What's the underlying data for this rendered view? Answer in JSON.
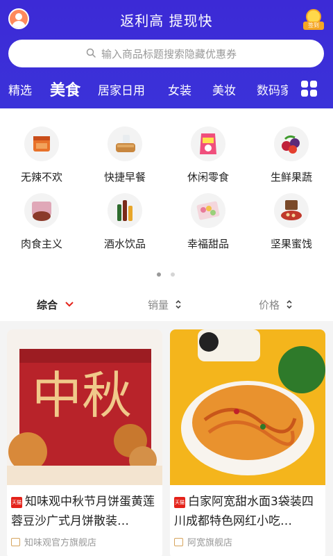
{
  "header": {
    "slogan": "返利高 提现快",
    "sign_badge_label": "签到"
  },
  "search": {
    "placeholder": "输入商品标题搜索隐藏优惠券"
  },
  "tabs": [
    {
      "label": "精选",
      "active": false
    },
    {
      "label": "美食",
      "active": true
    },
    {
      "label": "居家日用",
      "active": false
    },
    {
      "label": "女装",
      "active": false
    },
    {
      "label": "美妆",
      "active": false
    },
    {
      "label": "数码家",
      "active": false
    }
  ],
  "categories": [
    {
      "label": "无辣不欢",
      "icon": "spicy-snack-icon"
    },
    {
      "label": "快捷早餐",
      "icon": "bread-icon"
    },
    {
      "label": "休闲零食",
      "icon": "snack-bag-icon"
    },
    {
      "label": "生鲜果蔬",
      "icon": "fruit-icon"
    },
    {
      "label": "肉食主义",
      "icon": "meat-icon"
    },
    {
      "label": "酒水饮品",
      "icon": "drinks-icon"
    },
    {
      "label": "幸福甜品",
      "icon": "dessert-icon"
    },
    {
      "label": "坚果蜜饯",
      "icon": "nuts-icon"
    }
  ],
  "pager": {
    "pages": 2,
    "current": 1
  },
  "sort": [
    {
      "label": "综合",
      "active": true,
      "icon": "chevron-down-icon"
    },
    {
      "label": "销量",
      "active": false,
      "icon": "sort-arrows-icon"
    },
    {
      "label": "价格",
      "active": false,
      "icon": "sort-arrows-icon"
    }
  ],
  "products": [
    {
      "badge": "天猫",
      "title": "知味观中秋节月饼蛋黄莲蓉豆沙广式月饼散装…",
      "shop": "知味观官方旗舰店",
      "image_text": "中秋"
    },
    {
      "badge": "天猫",
      "title": "白家阿宽甜水面3袋装四川成都特色网红小吃…",
      "shop": "阿宽旗舰店"
    }
  ],
  "colors": {
    "header_bg": "#3b2fd8",
    "accent_red": "#e4221a",
    "tmall_red": "#e4221a"
  }
}
